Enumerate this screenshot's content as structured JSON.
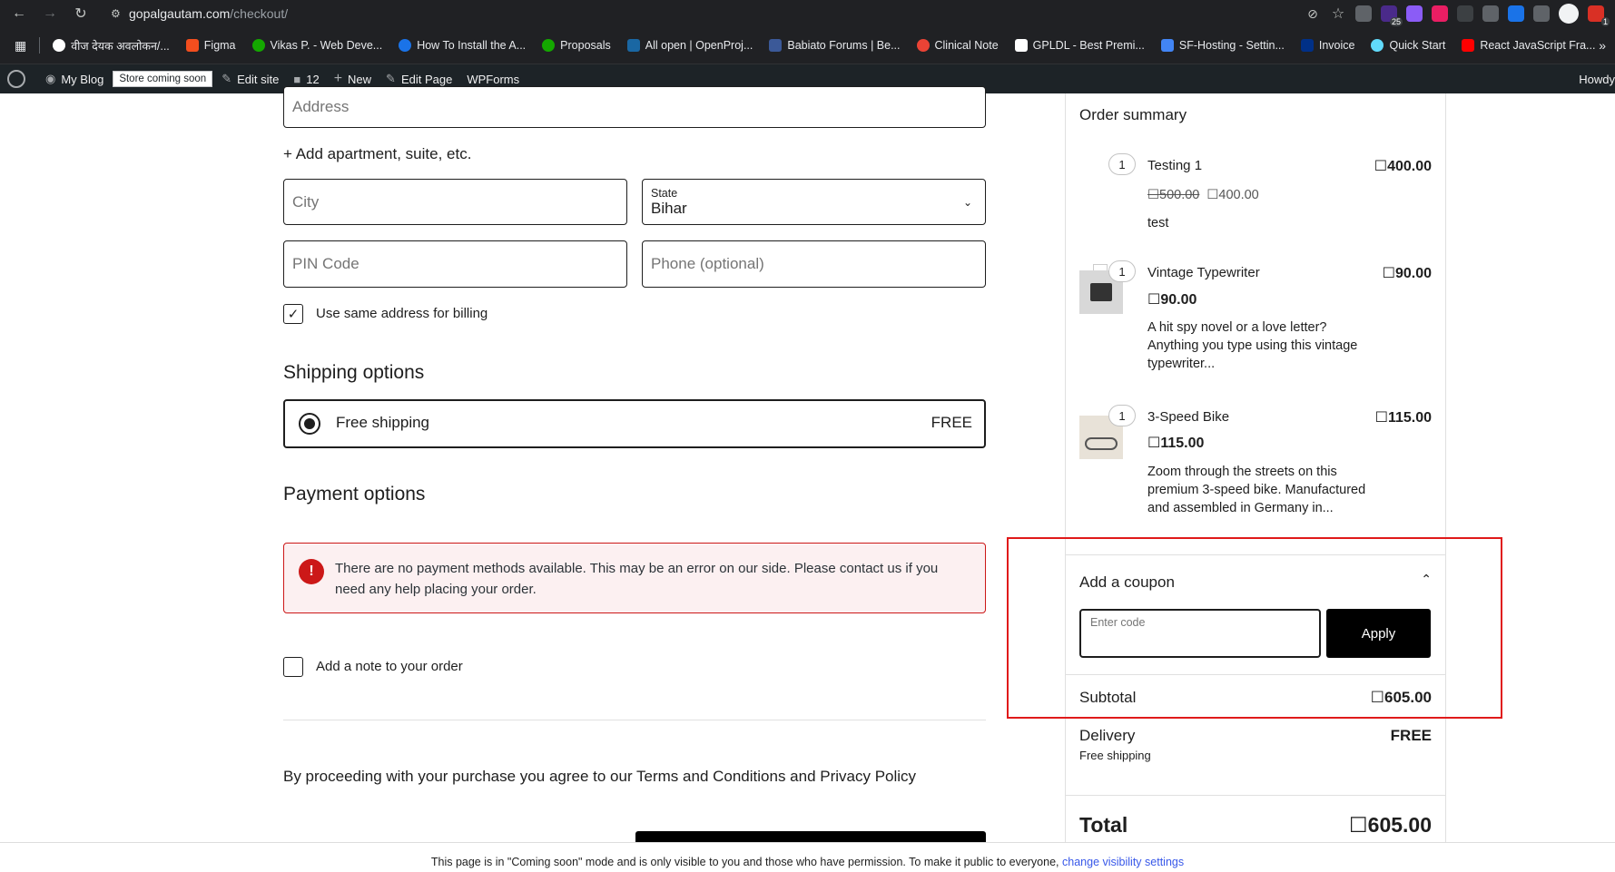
{
  "browser": {
    "url_host": "gopalgautam.com",
    "url_path": "/checkout/",
    "ext_badge_1": "25",
    "ext_badge_2": "1"
  },
  "bookmarks": [
    {
      "label": "वीज देयक अवलोकन/...",
      "color": "#ffffff"
    },
    {
      "label": "Figma",
      "color": "#f24e1e"
    },
    {
      "label": "Vikas P. - Web Deve...",
      "color": "#14a800"
    },
    {
      "label": "How To Install the A...",
      "color": "#1a73e8"
    },
    {
      "label": "Proposals",
      "color": "#14a800"
    },
    {
      "label": "All open | OpenProj...",
      "color": "#1a67a3"
    },
    {
      "label": "Babiato Forums | Be...",
      "color": "#3b5998"
    },
    {
      "label": "Clinical Note",
      "color": "#ea4335"
    },
    {
      "label": "GPLDL - Best Premi...",
      "color": "#ffffff"
    },
    {
      "label": "SF-Hosting - Settin...",
      "color": "#4285f4"
    },
    {
      "label": "Invoice",
      "color": "#003087"
    },
    {
      "label": "Quick Start",
      "color": "#61dafb"
    },
    {
      "label": "React JavaScript Fra...",
      "color": "#ff0000"
    }
  ],
  "wpbar": {
    "my_blog": "My Blog",
    "store_badge": "Store coming soon",
    "edit_site": "Edit site",
    "comments": "12",
    "new": "New",
    "edit_page": "Edit Page",
    "wpforms": "WPForms",
    "howdy": "Howdy"
  },
  "form": {
    "address_placeholder": "Address",
    "add_apartment": "+ Add apartment, suite, etc.",
    "city_placeholder": "City",
    "state_label": "State",
    "state_value": "Bihar",
    "pin_placeholder": "PIN Code",
    "phone_placeholder": "Phone (optional)",
    "same_billing": "Use same address for billing",
    "shipping_title": "Shipping options",
    "shipping_option": "Free shipping",
    "shipping_price": "FREE",
    "payment_title": "Payment options",
    "payment_error": "There are no payment methods available. This may be an error on our side. Please contact us if you need any help placing your order.",
    "add_note": "Add a note to your order",
    "terms": "By proceeding with your purchase you agree to our Terms and Conditions and Privacy Policy"
  },
  "summary": {
    "title": "Order summary",
    "items": [
      {
        "qty": "1",
        "name": "Testing 1",
        "price": "☐400.00",
        "old_price": "☐500.00",
        "sale_price": "☐400.00",
        "desc": "test"
      },
      {
        "qty": "1",
        "name": "Vintage Typewriter",
        "price": "☐90.00",
        "unit_price": "☐90.00",
        "desc": "A hit spy novel or a love letter? Anything you type using this vintage typewriter..."
      },
      {
        "qty": "1",
        "name": "3-Speed Bike",
        "price": "☐115.00",
        "unit_price": "☐115.00",
        "desc": "Zoom through the streets on this premium 3-speed bike. Manufactured and assembled in Germany in..."
      }
    ],
    "coupon_title": "Add a coupon",
    "coupon_placeholder": "Enter code",
    "apply": "Apply",
    "subtotal_label": "Subtotal",
    "subtotal_value": "☐605.00",
    "delivery_label": "Delivery",
    "delivery_value": "FREE",
    "delivery_sub": "Free shipping",
    "total_label": "Total",
    "total_value": "☐605.00"
  },
  "footer": {
    "text": "This page is in \"Coming soon\" mode and is only visible to you and those who have permission. To make it public to everyone,",
    "link": "change visibility settings"
  },
  "colors": {
    "error": "#cc1818",
    "highlight": "#e01a1a",
    "link": "#3858e9"
  }
}
